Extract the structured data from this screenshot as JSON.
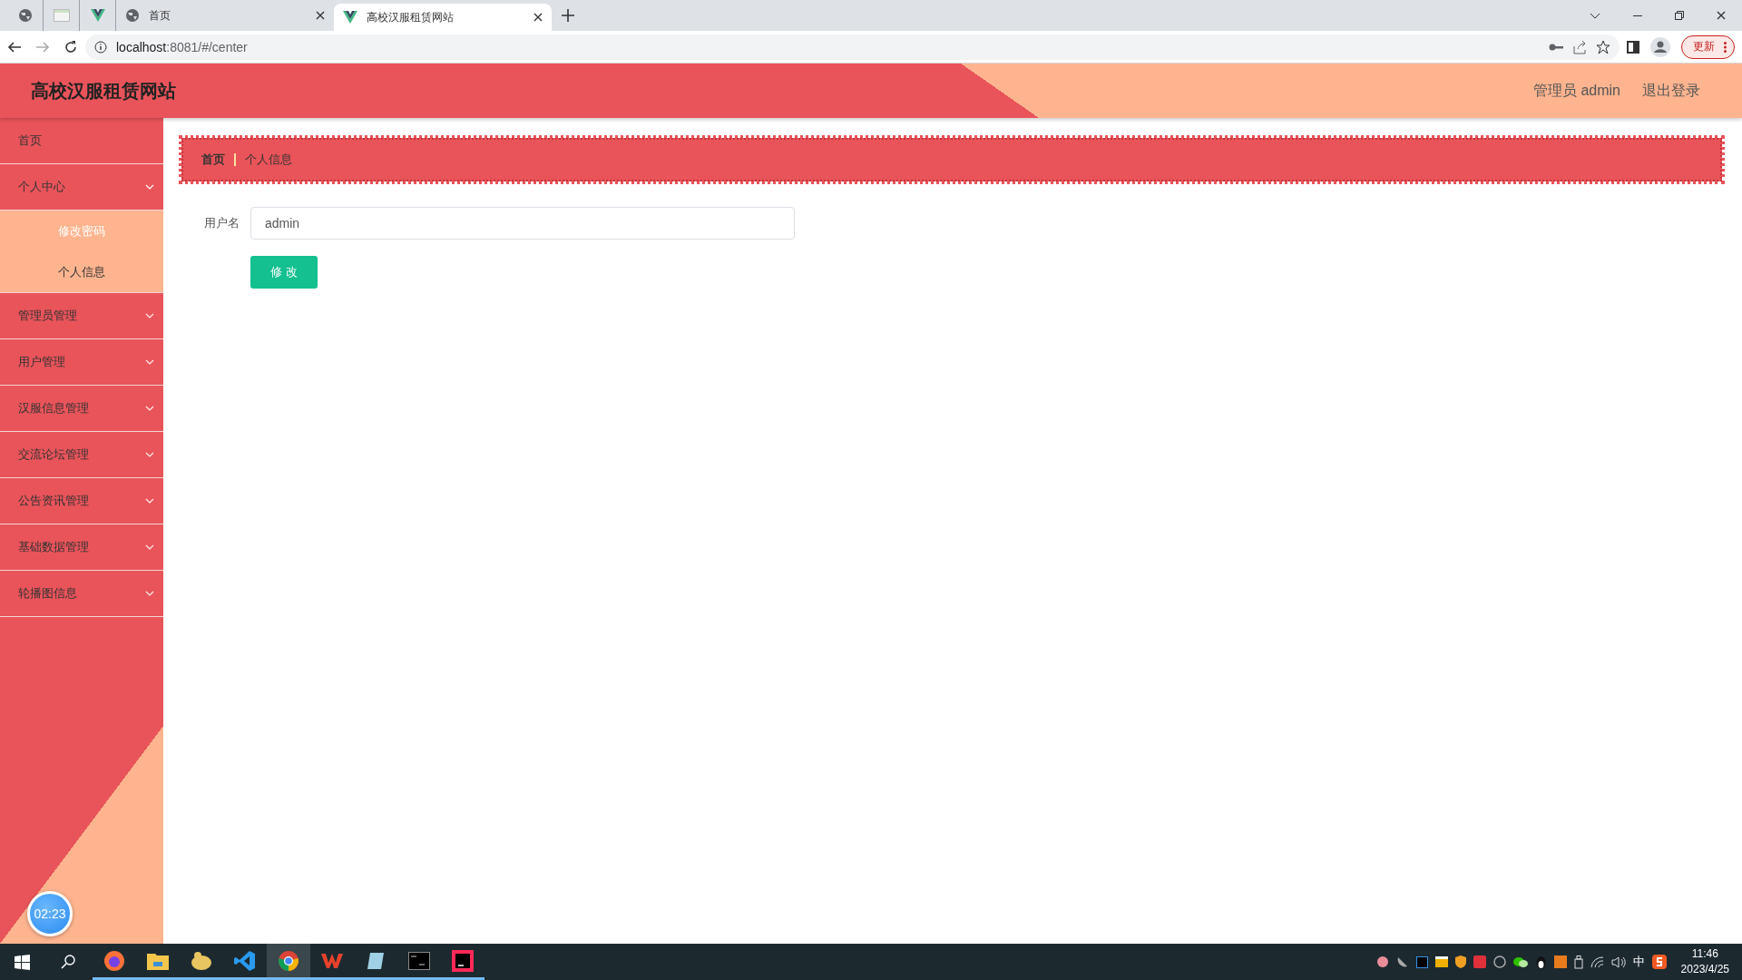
{
  "browser": {
    "tabs": [
      {
        "kind": "page",
        "label": "首页",
        "selected": false
      },
      {
        "kind": "site",
        "label": "高校汉服租赁网站",
        "selected": true
      }
    ],
    "address_host": "localhost",
    "address_path": ":8081/#/center",
    "update_button": "更新"
  },
  "header": {
    "title": "高校汉服租赁网站",
    "user": "管理员 admin",
    "logout": "退出登录"
  },
  "sidebar": {
    "items": [
      {
        "kind": "link",
        "label": "首页"
      },
      {
        "kind": "menu",
        "label": "个人中心",
        "expanded": true,
        "children": [
          {
            "label": "修改密码",
            "hovered": true
          },
          {
            "label": "个人信息",
            "hovered": false
          }
        ]
      },
      {
        "kind": "menu",
        "label": "管理员管理",
        "expanded": false
      },
      {
        "kind": "menu",
        "label": "用户管理",
        "expanded": false
      },
      {
        "kind": "menu",
        "label": "汉服信息管理",
        "expanded": false
      },
      {
        "kind": "menu",
        "label": "交流论坛管理",
        "expanded": false
      },
      {
        "kind": "menu",
        "label": "公告资讯管理",
        "expanded": false
      },
      {
        "kind": "menu",
        "label": "基础数据管理",
        "expanded": false
      },
      {
        "kind": "menu",
        "label": "轮播图信息",
        "expanded": false
      }
    ]
  },
  "breadcrumb": [
    "首页",
    "个人信息"
  ],
  "form": {
    "fields": [
      {
        "label": "用户名",
        "value": "admin"
      }
    ],
    "submit": "修 改"
  },
  "timer": "02:23",
  "taskbar": {
    "apps": [
      {
        "kind": "firefox",
        "active": false
      },
      {
        "kind": "folder",
        "active": false
      },
      {
        "kind": "navicat",
        "active": false
      },
      {
        "kind": "vscode",
        "active": false
      },
      {
        "kind": "chrome",
        "active": true
      },
      {
        "kind": "wps",
        "active": false
      },
      {
        "kind": "notepad",
        "active": false
      },
      {
        "kind": "terminal",
        "active": false
      },
      {
        "kind": "idea",
        "active": false
      }
    ],
    "ime": "中",
    "time": "11:46",
    "date": "2023/4/25"
  }
}
